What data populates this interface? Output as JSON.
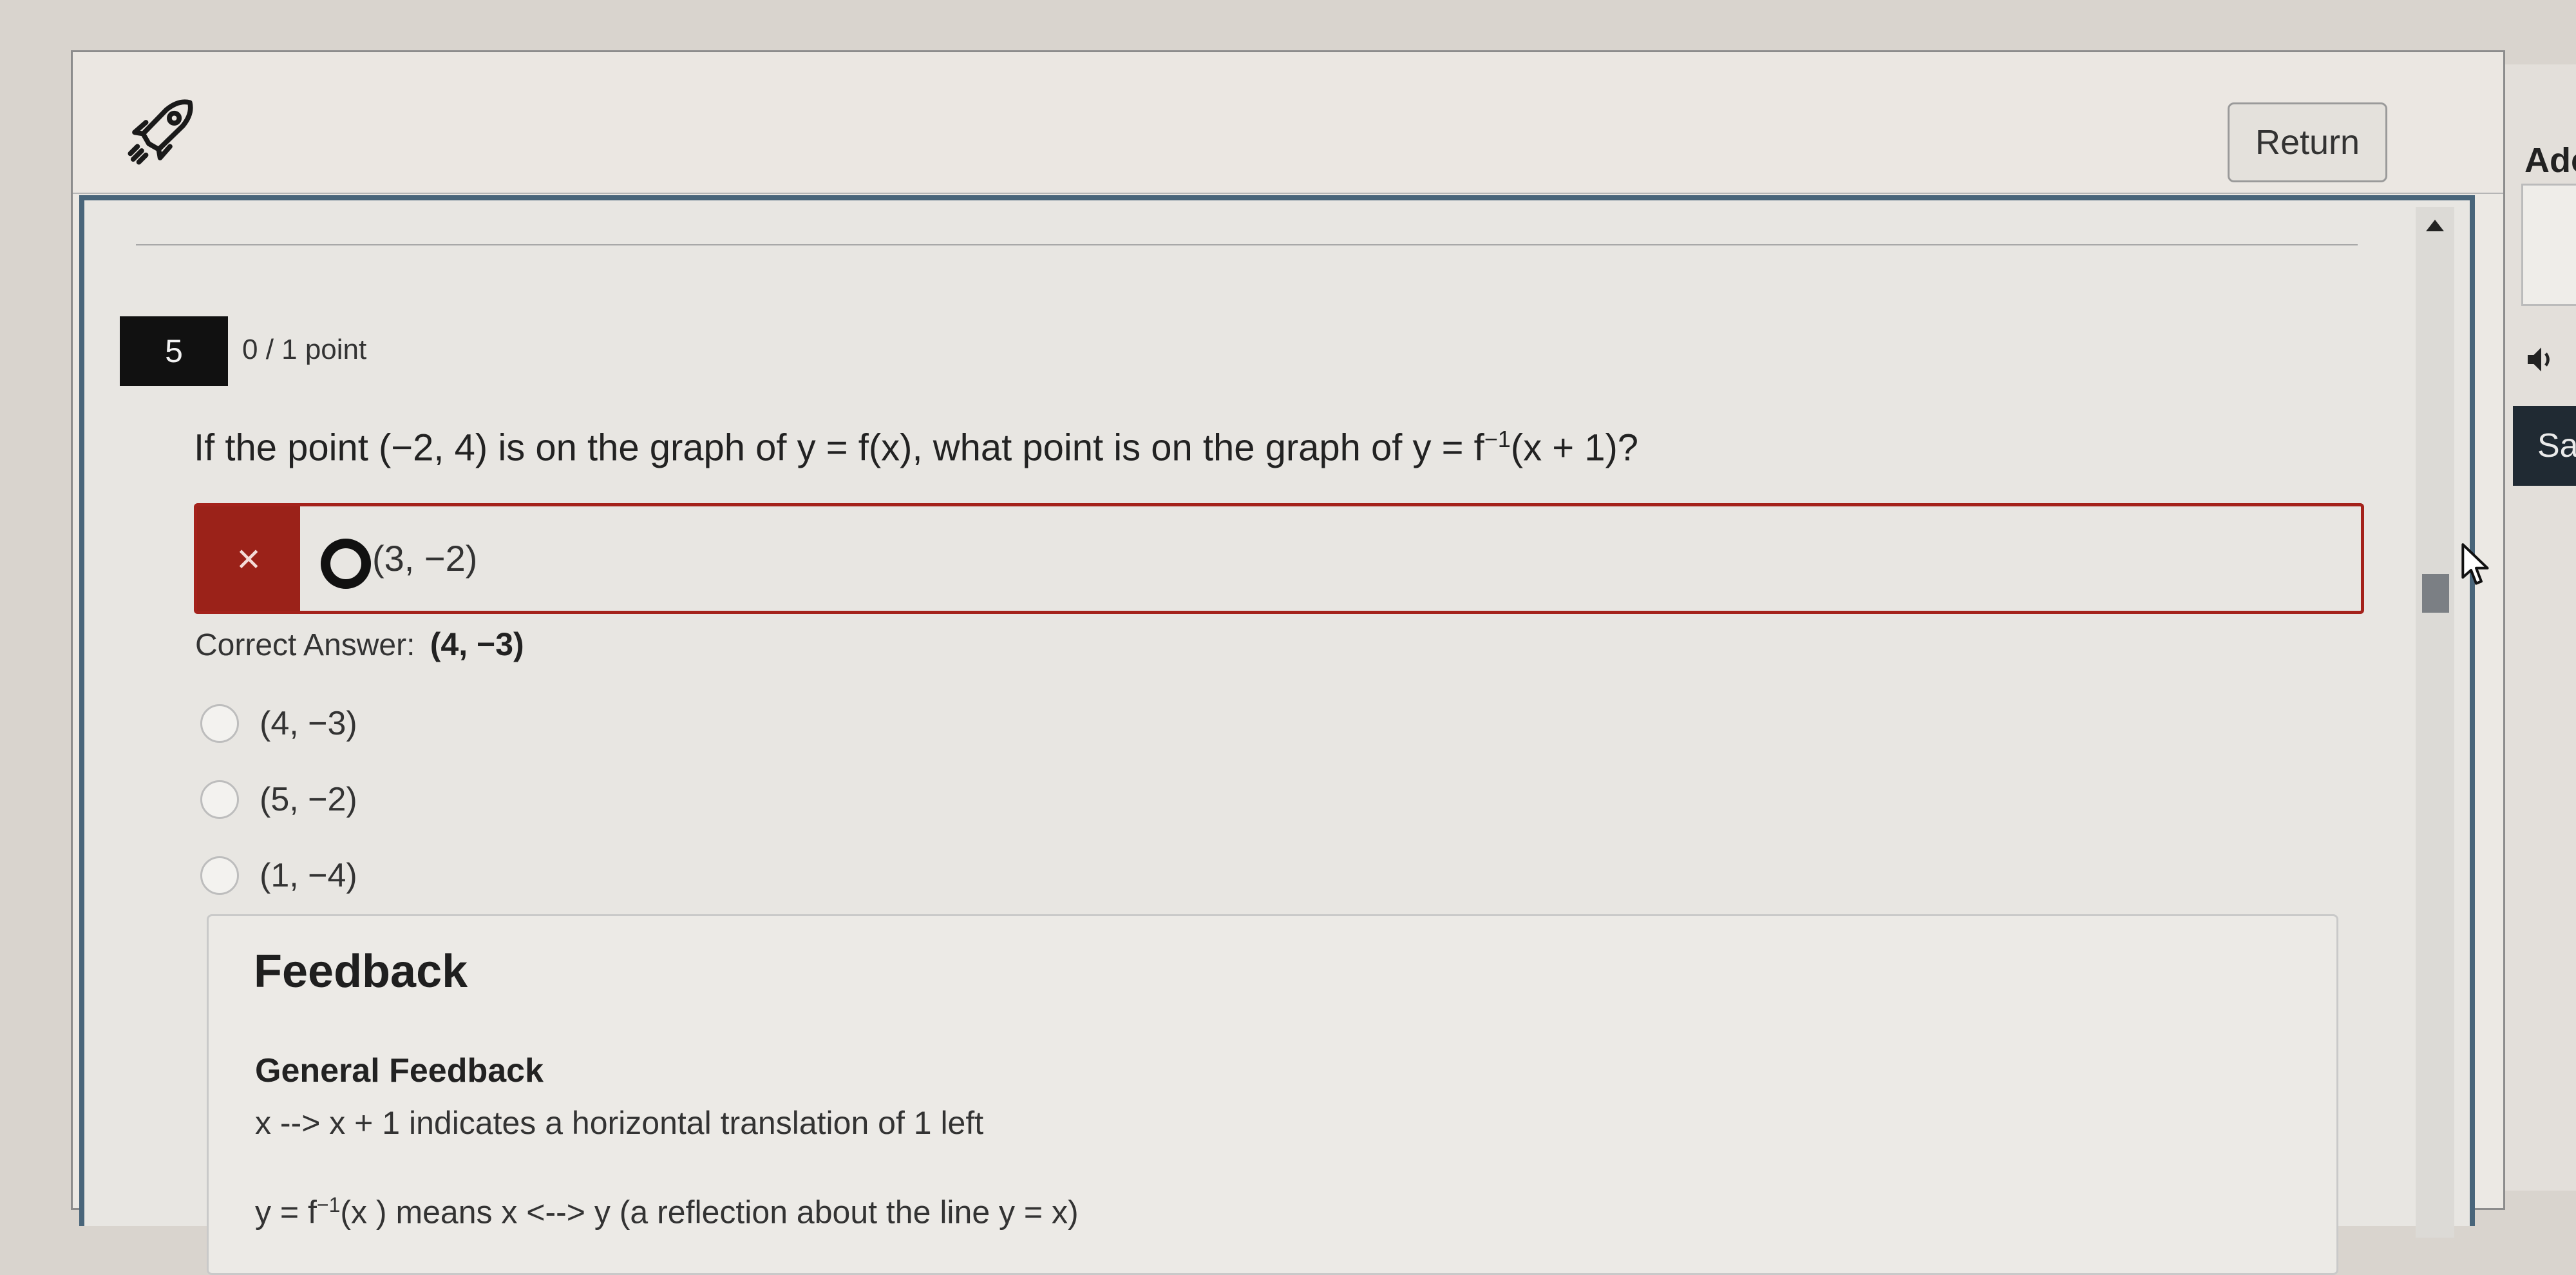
{
  "header": {
    "return_label": "Return"
  },
  "question": {
    "number": "5",
    "points": "0 / 1 point",
    "text_main": "If the point (−2, 4) is on the graph of y = f(x), what point is on the graph of y = f",
    "text_sup": "−1",
    "text_end": "(x + 1)?",
    "selected_answer": "(3, −2)",
    "wrong_mark": "×",
    "correct_label": "Correct Answer:",
    "correct_value": "(4, −3)",
    "options": [
      "(4, −3)",
      "(5, −2)",
      "(1, −4)"
    ]
  },
  "feedback": {
    "title": "Feedback",
    "general_title": "General Feedback",
    "line1": "x --> x + 1 indicates a horizontal translation of 1 left",
    "line2_start": "y = f",
    "line2_sup": "−1",
    "line2_end": "(x ) means x <--> y (a reflection about the line y = x)"
  },
  "sidebar": {
    "label": "Adc",
    "save_label": "Sa"
  },
  "colors": {
    "wrong": "#9b2219",
    "panel_border": "#49657a",
    "question_badge": "#111111"
  }
}
